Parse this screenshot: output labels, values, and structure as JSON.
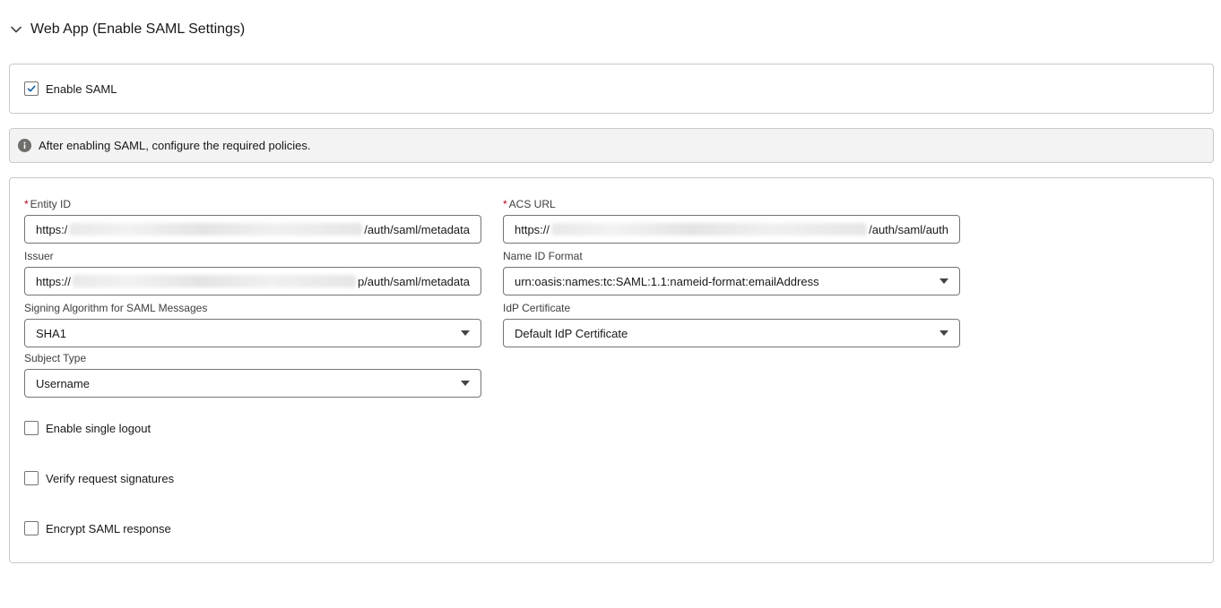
{
  "section": {
    "title": "Web App (Enable SAML Settings)"
  },
  "enable_saml": {
    "label": "Enable SAML",
    "checked": true
  },
  "info": {
    "message": "After enabling SAML, configure the required policies."
  },
  "form": {
    "entity_id": {
      "label": "Entity ID",
      "required": true,
      "prefix": "https:/",
      "suffix": "/auth/saml/metadata"
    },
    "acs_url": {
      "label": "ACS URL",
      "required": true,
      "prefix": "https://",
      "suffix": "/auth/saml/auth"
    },
    "issuer": {
      "label": "Issuer",
      "prefix": "https://",
      "suffix": "p/auth/saml/metadata"
    },
    "name_id_format": {
      "label": "Name ID Format",
      "value": "urn:oasis:names:tc:SAML:1.1:nameid-format:emailAddress"
    },
    "signing_algorithm": {
      "label": "Signing Algorithm for SAML Messages",
      "value": "SHA1"
    },
    "idp_certificate": {
      "label": "IdP Certificate",
      "value": "Default IdP Certificate"
    },
    "subject_type": {
      "label": "Subject Type",
      "value": "Username"
    },
    "checkboxes": [
      {
        "label": "Enable single logout",
        "checked": false
      },
      {
        "label": "Verify request signatures",
        "checked": false
      },
      {
        "label": "Encrypt SAML response",
        "checked": false
      }
    ],
    "required_marker": "*"
  }
}
